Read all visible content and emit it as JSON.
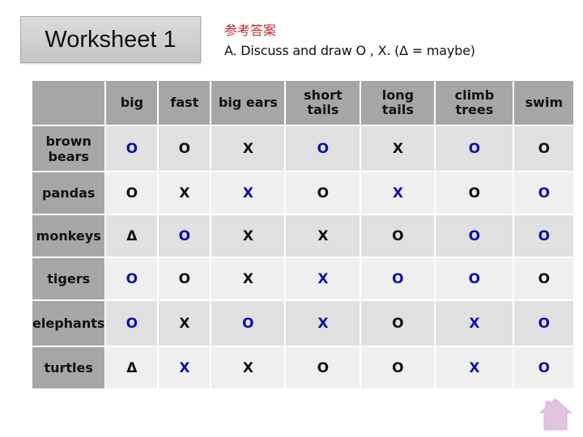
{
  "header": {
    "title": "Worksheet 1",
    "answer_label": "参考答案",
    "instruction": "A. Discuss and draw O , X. (Δ = maybe)"
  },
  "colors": {
    "answer_label": "#c0282d",
    "mark_blue": "#1010a8",
    "mark_black": "#111111",
    "header_bg": "#a6a6a6",
    "row_odd_bg": "#e0e0e0",
    "row_even_bg": "#efefef",
    "home_icon": "#e2c4df"
  },
  "table": {
    "columns": [
      "big",
      "fast",
      "big ears",
      "short tails",
      "long tails",
      "climb trees",
      "swim"
    ],
    "rows": [
      {
        "label": "brown bears",
        "cells": [
          {
            "mark": "O",
            "color": "blue"
          },
          {
            "mark": "O",
            "color": "black"
          },
          {
            "mark": "X",
            "color": "black"
          },
          {
            "mark": "O",
            "color": "blue"
          },
          {
            "mark": "X",
            "color": "black"
          },
          {
            "mark": "O",
            "color": "blue"
          },
          {
            "mark": "O",
            "color": "black"
          }
        ]
      },
      {
        "label": "pandas",
        "cells": [
          {
            "mark": "O",
            "color": "black"
          },
          {
            "mark": "X",
            "color": "black"
          },
          {
            "mark": "X",
            "color": "blue"
          },
          {
            "mark": "O",
            "color": "black"
          },
          {
            "mark": "X",
            "color": "blue"
          },
          {
            "mark": "O",
            "color": "black"
          },
          {
            "mark": "O",
            "color": "blue"
          }
        ]
      },
      {
        "label": "monkeys",
        "cells": [
          {
            "mark": "Δ",
            "color": "black"
          },
          {
            "mark": "O",
            "color": "blue"
          },
          {
            "mark": "X",
            "color": "black"
          },
          {
            "mark": "X",
            "color": "black"
          },
          {
            "mark": "O",
            "color": "black"
          },
          {
            "mark": "O",
            "color": "blue"
          },
          {
            "mark": "O",
            "color": "blue"
          }
        ]
      },
      {
        "label": "tigers",
        "cells": [
          {
            "mark": "O",
            "color": "blue"
          },
          {
            "mark": "O",
            "color": "black"
          },
          {
            "mark": "X",
            "color": "black"
          },
          {
            "mark": "X",
            "color": "blue"
          },
          {
            "mark": "O",
            "color": "blue"
          },
          {
            "mark": "O",
            "color": "blue"
          },
          {
            "mark": "O",
            "color": "black"
          }
        ]
      },
      {
        "label": "elephants",
        "cells": [
          {
            "mark": "O",
            "color": "blue"
          },
          {
            "mark": "X",
            "color": "black"
          },
          {
            "mark": "O",
            "color": "blue"
          },
          {
            "mark": "X",
            "color": "blue"
          },
          {
            "mark": "O",
            "color": "black"
          },
          {
            "mark": "X",
            "color": "blue"
          },
          {
            "mark": "O",
            "color": "blue"
          }
        ]
      },
      {
        "label": "turtles",
        "cells": [
          {
            "mark": "Δ",
            "color": "black"
          },
          {
            "mark": "X",
            "color": "blue"
          },
          {
            "mark": "X",
            "color": "black"
          },
          {
            "mark": "O",
            "color": "black"
          },
          {
            "mark": "O",
            "color": "black"
          },
          {
            "mark": "X",
            "color": "blue"
          },
          {
            "mark": "O",
            "color": "blue"
          }
        ]
      }
    ]
  },
  "footer": {
    "icon": "home-icon"
  }
}
